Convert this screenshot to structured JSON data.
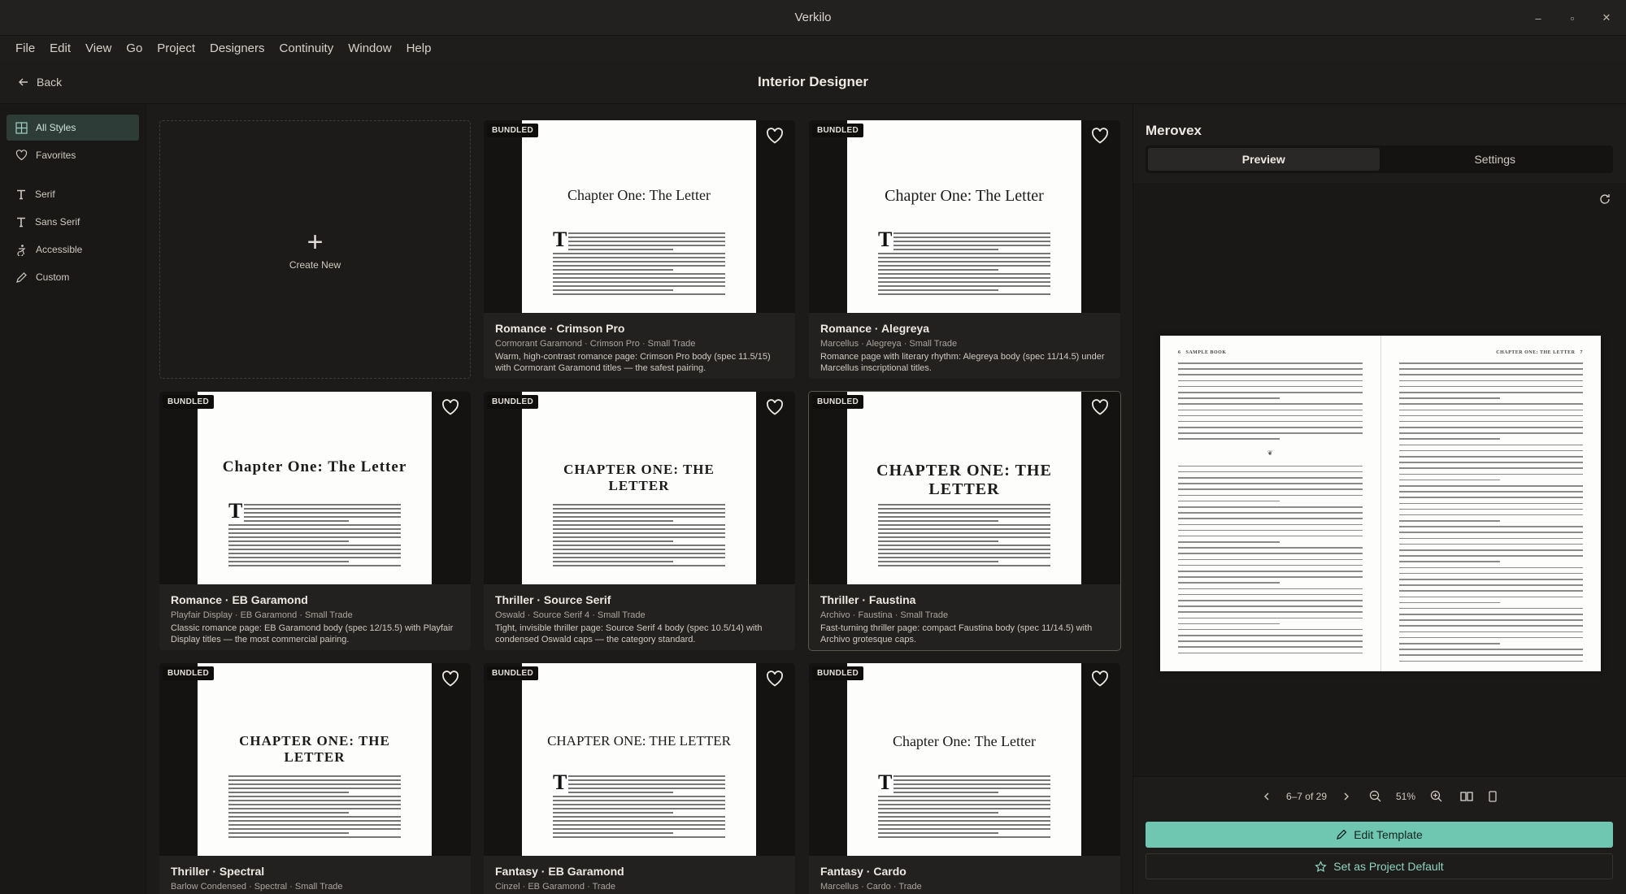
{
  "window": {
    "title": "Verkilo",
    "minimize": "–",
    "restore": "▫",
    "close": "✕"
  },
  "menu": [
    "File",
    "Edit",
    "View",
    "Go",
    "Project",
    "Designers",
    "Continuity",
    "Window",
    "Help"
  ],
  "appbar": {
    "back_label": "Back",
    "heading": "Interior Designer"
  },
  "sidebar": {
    "items": [
      {
        "label": "All Styles",
        "icon": "grid-icon",
        "active": true
      },
      {
        "label": "Favorites",
        "icon": "heart-icon",
        "active": false
      },
      {
        "label": "Serif",
        "icon": "type-icon",
        "active": false
      },
      {
        "label": "Sans Serif",
        "icon": "type-icon",
        "active": false
      },
      {
        "label": "Accessible",
        "icon": "accessibility-icon",
        "active": false
      },
      {
        "label": "Custom",
        "icon": "pen-icon",
        "active": false
      }
    ]
  },
  "create_new": {
    "label": "Create New",
    "icon": "+"
  },
  "badge_text": "BUNDLED",
  "cards": [
    {
      "name": "Romance · Crimson Pro",
      "meta": "Cormorant Garamond · Crimson Pro · Small Trade",
      "desc": "Warm, high-contrast romance page: Crimson Pro body (spec 11.5/15) with Cormorant Garamond titles — the safest pairing.",
      "chapter": "Chapter One: The Letter",
      "dropcap": "T"
    },
    {
      "name": "Romance · Alegreya",
      "meta": "Marcellus · Alegreya · Small Trade",
      "desc": "Romance page with literary rhythm: Alegreya body (spec 11/14.5) under Marcellus inscriptional titles.",
      "chapter": "Chapter One: The Letter",
      "dropcap": "T"
    },
    {
      "name": "Romance · EB Garamond",
      "meta": "Playfair Display · EB Garamond · Small Trade",
      "desc": "Classic romance page: EB Garamond body (spec 12/15.5) with Playfair Display titles — the most commercial pairing.",
      "chapter": "Chapter One: The Letter",
      "dropcap": "T"
    },
    {
      "name": "Thriller · Source Serif",
      "meta": "Oswald · Source Serif 4 · Small Trade",
      "desc": "Tight, invisible thriller page: Source Serif 4 body (spec 10.5/14) with condensed Oswald caps — the category standard.",
      "chapter": "CHAPTER ONE: THE LETTER",
      "dropcap": ""
    },
    {
      "name": "Thriller · Faustina",
      "meta": "Archivo · Faustina · Small Trade",
      "desc": "Fast-turning thriller page: compact Faustina body (spec 11/14.5) with Archivo grotesque caps.",
      "chapter": "CHAPTER ONE: THE LETTER",
      "dropcap": ""
    },
    {
      "name": "Thriller · Spectral",
      "meta": "Barlow Condensed · Spectral · Small Trade",
      "desc": "",
      "chapter": "CHAPTER ONE: THE LETTER",
      "dropcap": ""
    },
    {
      "name": "Fantasy · EB Garamond",
      "meta": "Cinzel · EB Garamond · Trade",
      "desc": "",
      "chapter": "CHAPTER ONE: THE LETTER",
      "dropcap": "T"
    },
    {
      "name": "Fantasy · Cardo",
      "meta": "Marcellus · Cardo · Trade",
      "desc": "",
      "chapter": "Chapter One: The Letter",
      "dropcap": "T"
    }
  ],
  "panel": {
    "title": "Merovex",
    "tabs": [
      "Preview",
      "Settings"
    ],
    "spread": {
      "left_header_num": "6",
      "left_header": "SAMPLE BOOK",
      "right_header": "CHAPTER ONE: THE LETTER",
      "right_header_num": "7",
      "ornament": "❦"
    },
    "pager": {
      "range": "6–7 of 29",
      "zoom": "51%"
    },
    "edit_button": "Edit Template",
    "default_button": "Set as Project Default"
  }
}
